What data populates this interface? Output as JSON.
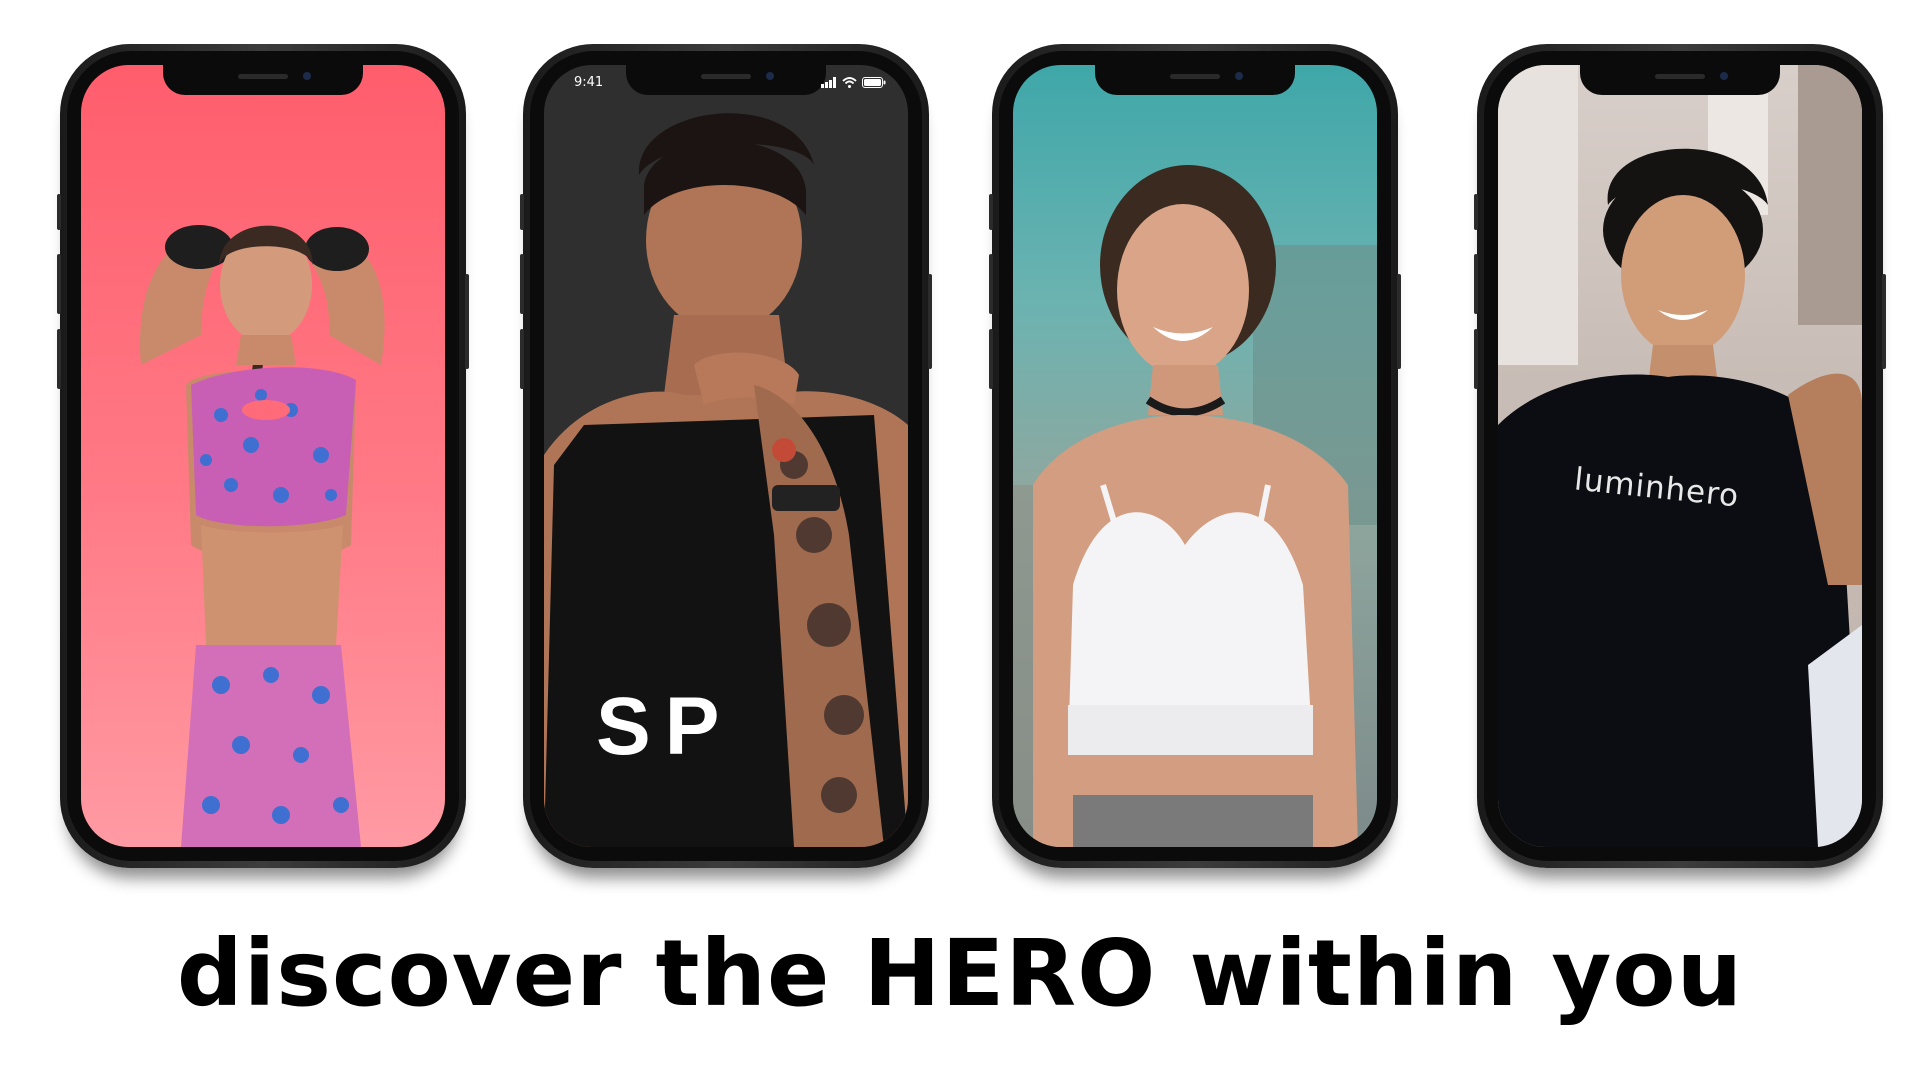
{
  "tagline": "discover the HERO within you",
  "phones": [
    {
      "screen_color": "#ff6b78"
    },
    {
      "screen_color": "#2f2f2f",
      "status_time": "9:41",
      "shirt_text": "SP"
    },
    {
      "screen_color": "#5fb0ae"
    },
    {
      "screen_color": "#cfc5bf",
      "shirt_text": "luminhero"
    }
  ]
}
